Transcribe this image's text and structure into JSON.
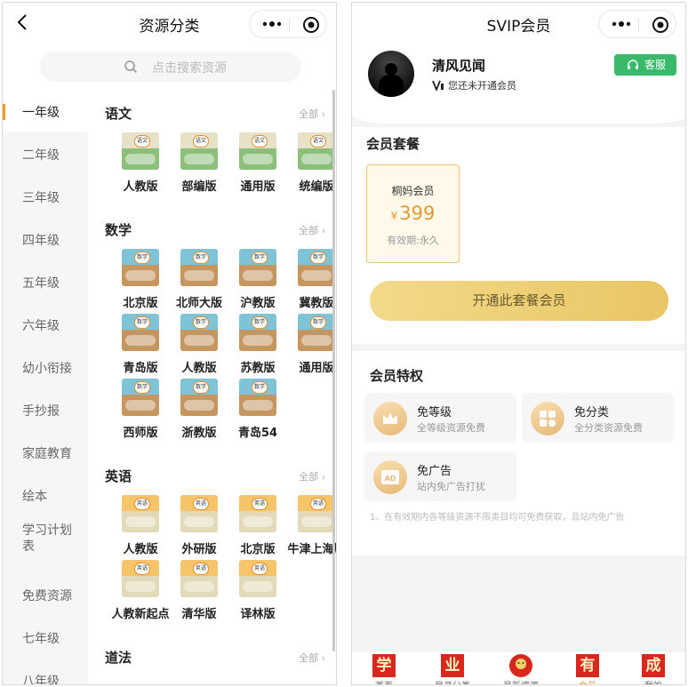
{
  "left": {
    "title": "资源分类",
    "search_placeholder": "点击搜索资源",
    "sidebar": [
      {
        "label": "一年级",
        "active": true
      },
      {
        "label": "二年级"
      },
      {
        "label": "三年级"
      },
      {
        "label": "四年级"
      },
      {
        "label": "五年级"
      },
      {
        "label": "六年级"
      },
      {
        "label": "幼小衔接"
      },
      {
        "label": "手抄报"
      },
      {
        "label": "家庭教育"
      },
      {
        "label": "绘本"
      },
      {
        "label": "学习计划表"
      },
      {
        "label": "免费资源"
      },
      {
        "label": "七年级"
      },
      {
        "label": "八年级"
      }
    ],
    "all_label": "全部",
    "sections": [
      {
        "title": "语文",
        "books": [
          "人教版",
          "部编版",
          "通用版",
          "统编版"
        ]
      },
      {
        "title": "数学",
        "books": [
          "北京版",
          "北师大版",
          "沪教版",
          "冀教版",
          "青岛版",
          "人教版",
          "苏教版",
          "通用版",
          "西师版",
          "浙教版",
          "青岛54"
        ]
      },
      {
        "title": "英语",
        "books": [
          "人教版",
          "外研版",
          "北京版",
          "牛津上海版",
          "人教新起点",
          "清华版",
          "译林版"
        ]
      },
      {
        "title": "道法",
        "books": []
      }
    ],
    "cover_badges": {
      "chinese": "语文",
      "math": "数学",
      "english": "英语"
    }
  },
  "right": {
    "title": "SVIP会员",
    "user": {
      "name": "清风见闻",
      "vip_status": "您还未开通会员"
    },
    "service_label": "客服",
    "package_section": "会员套餐",
    "package": {
      "name": "桐妈会员",
      "currency": "¥",
      "price": "399",
      "validity": "有效期:永久"
    },
    "open_button": "开通此套餐会员",
    "privilege_section": "会员特权",
    "privileges": [
      {
        "name": "免等级",
        "desc": "全等级资源免费",
        "icon": "crown-icon"
      },
      {
        "name": "免分类",
        "desc": "全分类资源免费",
        "icon": "category-icon"
      },
      {
        "name": "免广告",
        "desc": "站内免广告打扰",
        "icon": "ad-icon"
      }
    ],
    "note": "1、在有效期内各等级资源不限类目均可免费获取，且站内免广告",
    "tabs": [
      {
        "icon_char": "学",
        "label": "首页"
      },
      {
        "icon_char": "业",
        "label": "目录分类"
      },
      {
        "icon_char": "",
        "label": "最新资源"
      },
      {
        "icon_char": "有",
        "label": "会员",
        "active": true
      },
      {
        "icon_char": "成",
        "label": "我的"
      }
    ]
  },
  "colors": {
    "accent": "#f0a020",
    "gold": "#e39a2e",
    "green": "#39b96a",
    "tab_red": "#d8271f"
  }
}
